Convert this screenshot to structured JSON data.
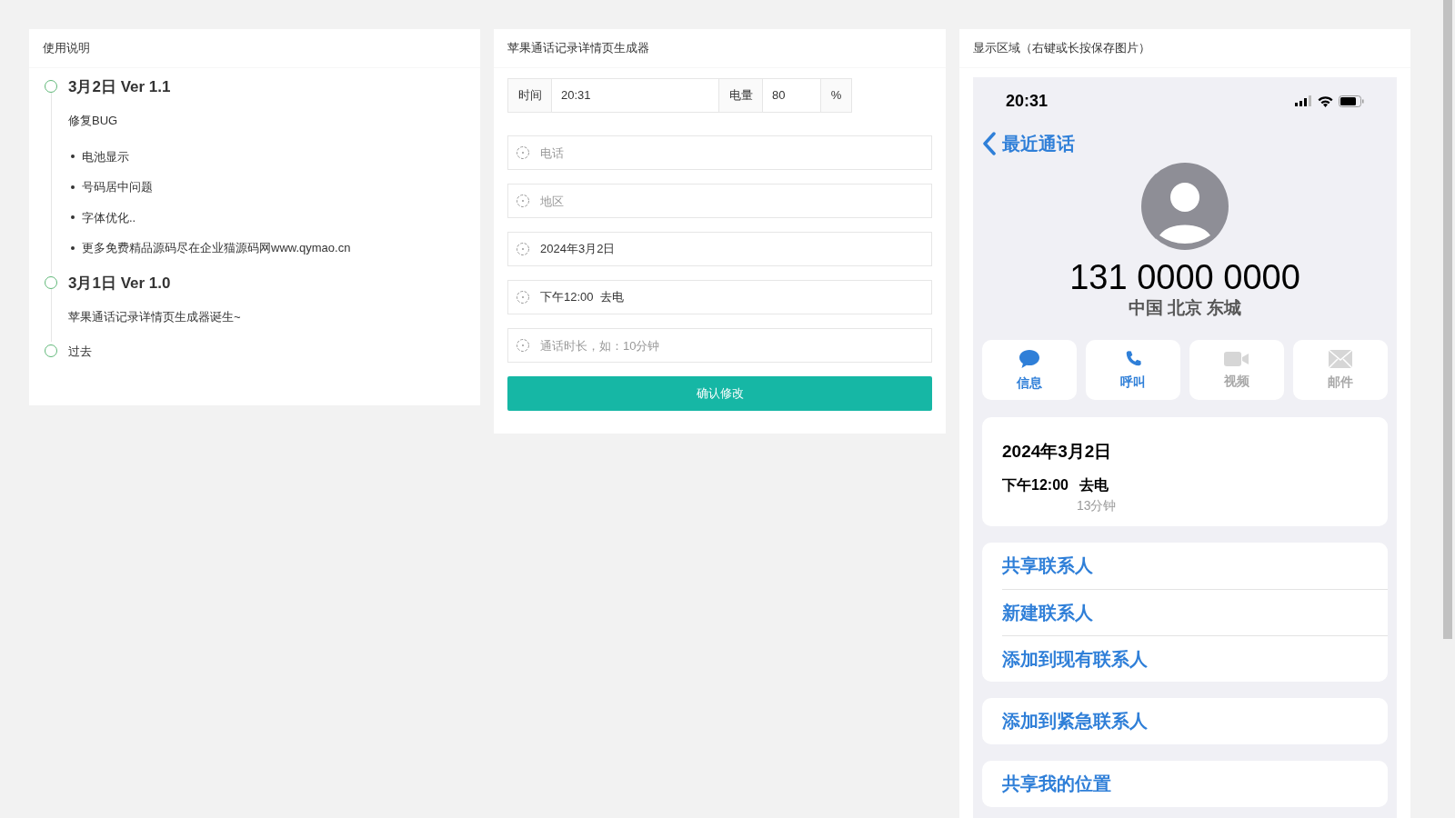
{
  "guide": {
    "title": "使用说明",
    "timeline": [
      {
        "kind": "version",
        "title": "3月2日 Ver 1.1",
        "description": "修复BUG",
        "bullets": [
          "电池显示",
          "号码居中问题",
          "字体优化..",
          "更多免费精品源码尽在企业猫源码网www.qymao.cn"
        ]
      },
      {
        "kind": "version",
        "title": "3月1日 Ver 1.0",
        "description": "苹果通话记录详情页生成器诞生~"
      },
      {
        "kind": "plain",
        "title": "过去"
      }
    ]
  },
  "generator": {
    "title": "苹果通话记录详情页生成器",
    "time": {
      "label": "时间",
      "value": "20:31"
    },
    "battery": {
      "label": "电量",
      "value": "80",
      "unit": "%"
    },
    "fields": [
      {
        "placeholder": "电话"
      },
      {
        "placeholder": "地区"
      },
      {
        "value": "2024年3月2日"
      },
      {
        "value": "下午12:00  去电"
      },
      {
        "placeholder": "通话时长，如：10分钟"
      }
    ],
    "submit": "确认修改"
  },
  "preview": {
    "title": "显示区域（右键或长按保存图片）",
    "status_time": "20:31",
    "back": "最近通话",
    "number": "131 0000 0000",
    "location": "中国 北京 东城",
    "actions": [
      {
        "kind": "message",
        "label": "信息",
        "disabled": false
      },
      {
        "kind": "call",
        "label": "呼叫",
        "disabled": false
      },
      {
        "kind": "video",
        "label": "视频",
        "disabled": true
      },
      {
        "kind": "mail",
        "label": "邮件",
        "disabled": true
      }
    ],
    "call": {
      "date": "2024年3月2日",
      "time": "下午12:00",
      "type": "去电",
      "duration": "13分钟"
    },
    "groups": [
      [
        "共享联系人",
        "新建联系人",
        "添加到现有联系人"
      ],
      [
        "添加到紧急联系人"
      ],
      [
        "共享我的位置"
      ]
    ]
  }
}
